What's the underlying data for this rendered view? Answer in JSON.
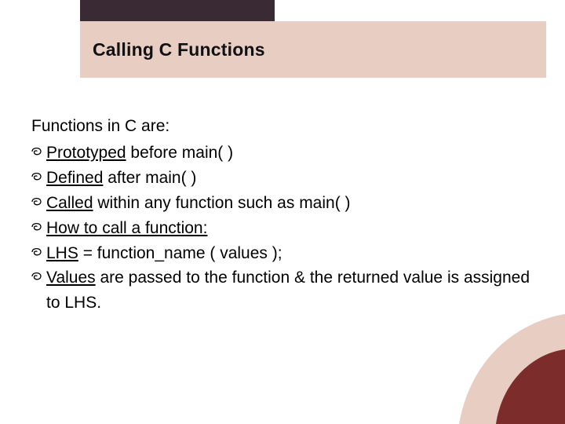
{
  "title": "Calling C Functions",
  "intro": "Functions in C are:",
  "bullets": [
    {
      "prefix": "Prototyped",
      "rest": " before main( )"
    },
    {
      "prefix": "Defined",
      "rest": " after main( )"
    },
    {
      "prefix": "Called",
      "rest": " within any function such as main( )"
    },
    {
      "prefix": "How",
      "rest": " to call a function:",
      "underlineRest": true
    },
    {
      "prefix": "LHS",
      "rest": " = function_name ( values );"
    },
    {
      "prefix": "Values",
      "rest": " are passed to the function & the returned value is assigned to LHS."
    }
  ],
  "colors": {
    "titleBar": "#e8cdc3",
    "topDark": "#3a2a33",
    "cornerOuter": "#e8cdc3",
    "cornerInner": "#7d2c2c"
  }
}
